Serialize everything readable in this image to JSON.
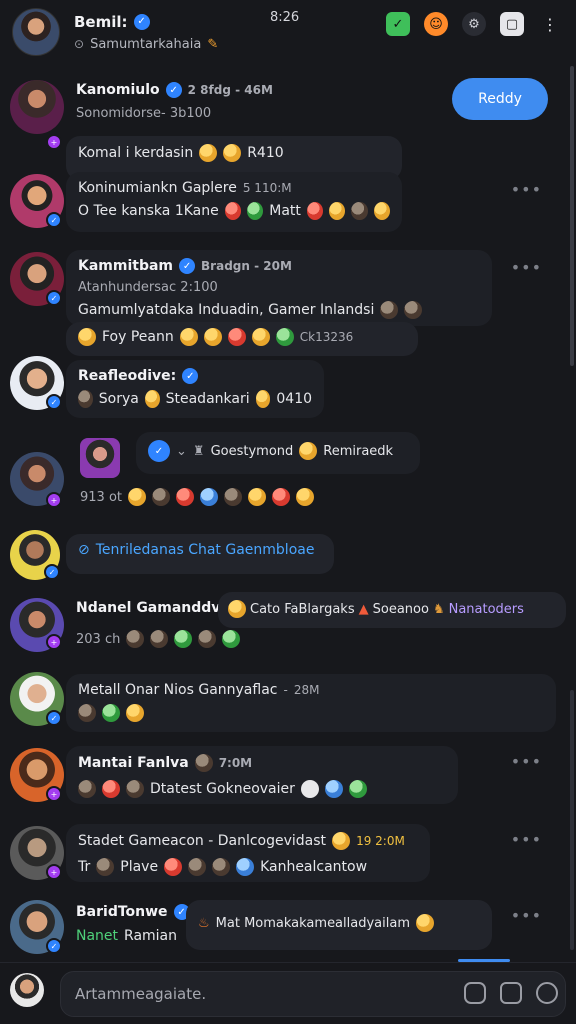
{
  "header": {
    "name": "Bemil:",
    "subtitle": "Samumtarkahaia",
    "time": "8:26",
    "icons": [
      "game-icon",
      "emoji-icon",
      "settings-icon",
      "square-icon",
      "more-icon"
    ]
  },
  "ready_button": "Reddy",
  "rows": [
    {
      "name": "Kanomiulo",
      "meta": "2 8fdg - 46M",
      "line1": "Sonomidorse- 3b100",
      "line2": "Komal i kerdasin",
      "line2_tail": "R410"
    },
    {
      "name": "Koninumiankn Gaplere",
      "meta": "5 110:M",
      "line1": "O Tee kanska 1Kane",
      "line1_tail": "Matt"
    },
    {
      "name": "Kammitbam",
      "meta": "Bradgn - 20M",
      "line1": "Atanhundersac 2:100",
      "line2": "Gamumlyatdaka Induadin, Gamer Inlandsi",
      "line3": "Foy Peann",
      "line3_tail": "Ck13236"
    },
    {
      "name": "Reafleodive:",
      "line1": "Sorya",
      "line1_mid": "Steadankari",
      "line1_tail": "0410"
    },
    {
      "name": "",
      "line1": "Goestymond",
      "line1_tail": "Remiraedk",
      "line2": "913 ot"
    },
    {
      "name": "Tenriledanas Chat Gaenmbloae"
    },
    {
      "name": "Ndanel Gamanddve",
      "side": "Cato FaBlargaks",
      "side2": "Soeanoo",
      "side3": "Nanatoders",
      "line1": "203 ch"
    },
    {
      "name": "Metall Onar Nios Gannyaflac",
      "meta": "28M"
    },
    {
      "name": "Mantai Fanlva",
      "meta": "7:0M",
      "line1": "Dtatest Gokneovaier"
    },
    {
      "name": "Stadet Gameacon - Danlcogevidast",
      "meta": "19 2:0M",
      "line1": "Tr",
      "line1_mid": "Plave",
      "line1_tail": "Kanhealcantow"
    },
    {
      "name": "BaridTonwe",
      "line1": "Nanet",
      "line1_tail": "Ramian",
      "message": "Mat Momakakamealladyailam"
    }
  ],
  "composer": {
    "placeholder": "Artammeagaiate.",
    "icons": [
      "sticker-icon",
      "camera-icon",
      "emoji-icon"
    ]
  },
  "colors": {
    "accent": "#3f8cf0",
    "background": "#17181c",
    "bubble": "#22242b",
    "purple_badge": "#a33df0"
  }
}
